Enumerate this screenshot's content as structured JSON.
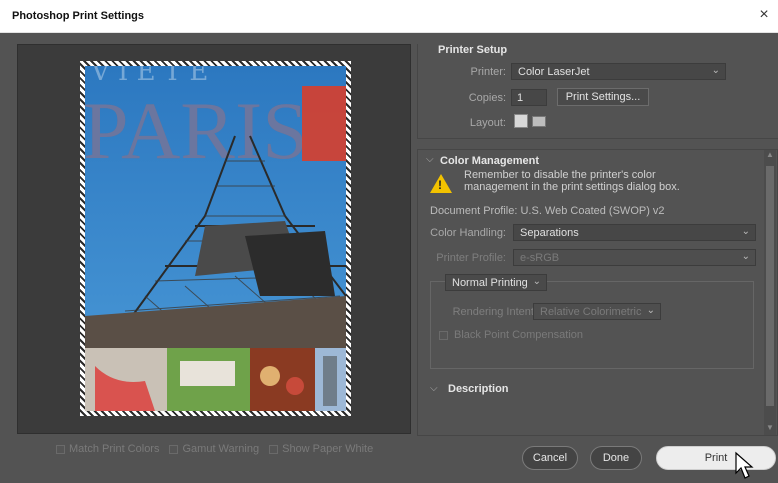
{
  "window": {
    "title": "Photoshop Print Settings",
    "close": "×"
  },
  "preview": {
    "headline": "PARIS",
    "options": [
      "Match Print Colors",
      "Gamut Warning",
      "Show Paper White"
    ]
  },
  "printer_setup": {
    "heading": "Printer Setup",
    "printer_label": "Printer:",
    "printer_value": "Color LaserJet",
    "copies_label": "Copies:",
    "copies_value": "1",
    "print_settings_button": "Print Settings...",
    "layout_label": "Layout:"
  },
  "color_management": {
    "heading": "Color Management",
    "warning_line1": "Remember to disable the printer's color",
    "warning_line2": "management in the print settings dialog box.",
    "document_profile": "Document Profile: U.S. Web Coated (SWOP) v2",
    "color_handling_label": "Color Handling:",
    "color_handling_value": "Separations",
    "printer_profile_label": "Printer Profile:",
    "printer_profile_value": "e-sRGB",
    "printing_mode": "Normal Printing",
    "rendering_intent_label": "Rendering Intent:",
    "rendering_intent_value": "Relative Colorimetric",
    "black_point": "Black Point Compensation"
  },
  "description": {
    "heading": "Description"
  },
  "buttons": {
    "cancel": "Cancel",
    "done": "Done",
    "print": "Print"
  },
  "colors": {
    "dialog_bg": "#535353",
    "preview_bg": "#3b3b3b",
    "warning": "#f2c200",
    "paris_red": "#e23b23"
  }
}
